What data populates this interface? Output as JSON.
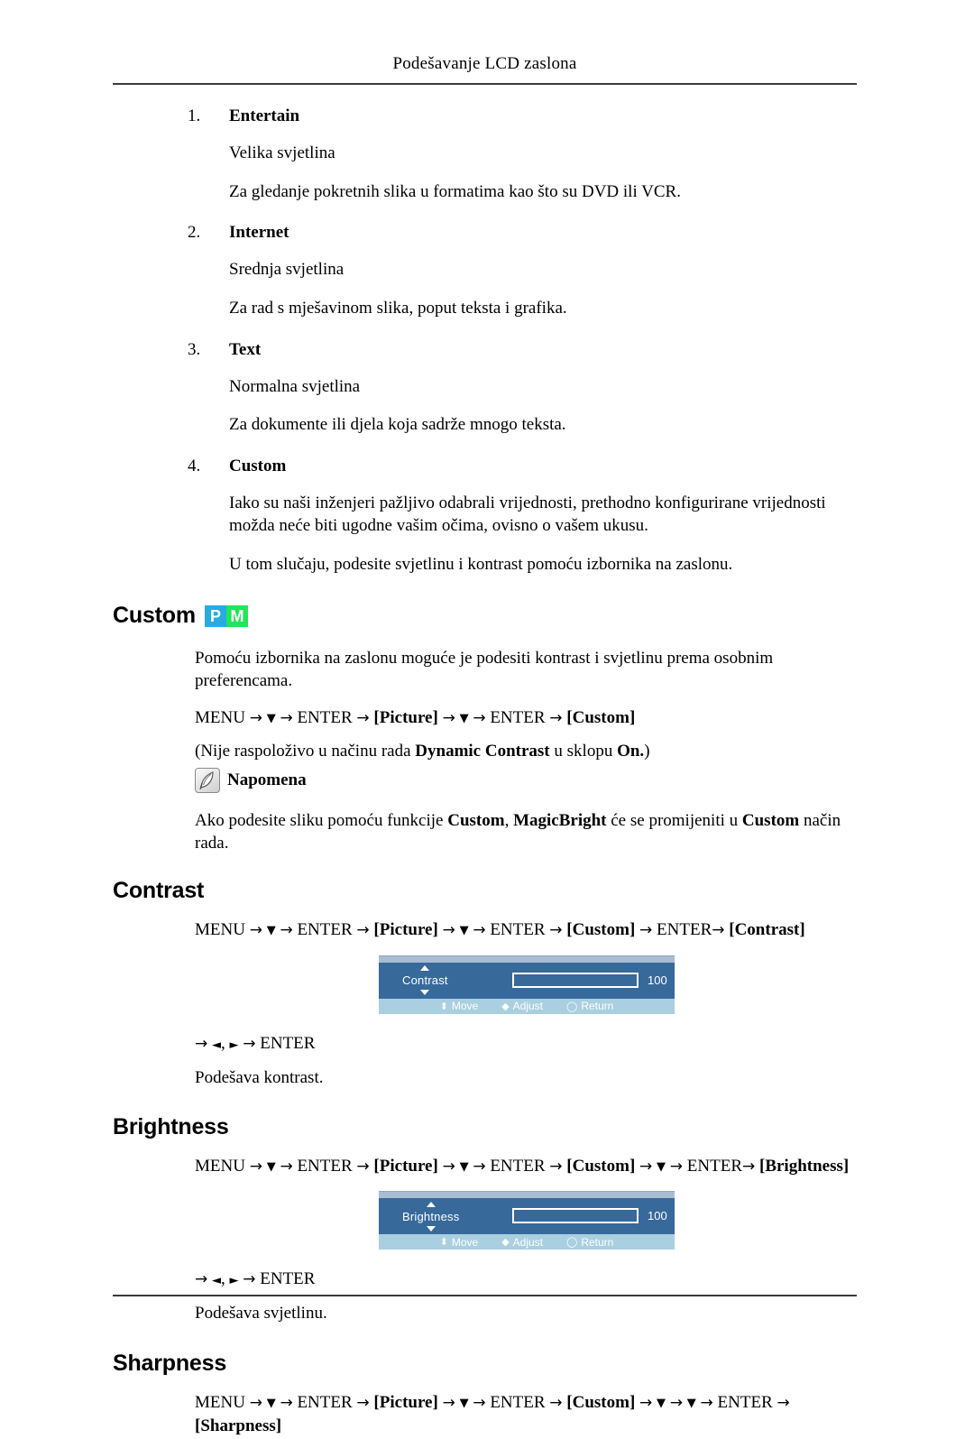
{
  "page": {
    "header_title": "Podešavanje LCD zaslona"
  },
  "magicbright_modes": [
    {
      "number": "1.",
      "title": "Entertain",
      "brightness": "Velika svjetlina",
      "description": "Za gledanje pokretnih slika u formatima kao što su DVD ili VCR."
    },
    {
      "number": "2.",
      "title": "Internet",
      "brightness": "Srednja svjetlina",
      "description": "Za rad s mješavinom slika, poput teksta i grafika."
    },
    {
      "number": "3.",
      "title": "Text",
      "brightness": "Normalna svjetlina",
      "description": "Za dokumente ili djela koja sadrže mnogo teksta."
    },
    {
      "number": "4.",
      "title": "Custom",
      "brightness": "Iako su naši inženjeri pažljivo odabrali vrijednosti, prethodno konfigurirane vrijednosti možda neće biti ugodne vašim očima, ovisno o vašem ukusu.",
      "description": "U tom slučaju, podesite svjetlinu i kontrast pomoću izbornika na zaslonu."
    }
  ],
  "custom_section": {
    "heading": "Custom",
    "badge_p": "P",
    "badge_m": "M",
    "badge_p_color": "#29abe2",
    "badge_m_color": "#22e559",
    "intro": "Pomoću izbornika na zaslonu moguće je podesiti kontrast i svjetlinu prema osobnim preferencama.",
    "menu_path": {
      "start": "MENU",
      "enter1": "ENTER",
      "picture": "[Picture]",
      "enter2": "ENTER",
      "target": "[Custom]"
    },
    "availability_note_pre": "(Nije raspoloživo u načinu rada ",
    "availability_note_bold1": "Dynamic Contrast",
    "availability_note_mid": " u sklopu ",
    "availability_note_bold2": "On.",
    "availability_note_post": ")",
    "note_label": "Napomena",
    "note_icon": "quill-note-icon",
    "note_text_pre": "Ako podesite sliku pomoću funkcije ",
    "note_text_b1": "Custom",
    "note_text_mid1": ", ",
    "note_text_b2": "MagicBright",
    "note_text_mid2": " će se promijeniti u ",
    "note_text_b3": "Custom",
    "note_text_post": " način rada."
  },
  "contrast_section": {
    "heading": "Contrast",
    "menu_path": {
      "start": "MENU",
      "enter1": "ENTER",
      "picture": "[Picture]",
      "enter2": "ENTER",
      "custom": "[Custom]",
      "enter3": "ENTER",
      "target": "[Contrast]"
    },
    "osd": {
      "label": "Contrast",
      "value": "100",
      "fill_percent": 100,
      "footer": [
        {
          "icon": "updown-arrow-icon",
          "glyph": "⬍",
          "label": "Move"
        },
        {
          "icon": "leftright-arrow-icon",
          "glyph": "◆",
          "label": "Adjust"
        },
        {
          "icon": "return-circle-icon",
          "glyph": "◯",
          "label": "Return"
        }
      ],
      "bg_color": "#37699b",
      "bar_color": "#eab94b",
      "footer_color": "#a9cfe0"
    },
    "key_hint": "ENTER",
    "description": "Podešava kontrast."
  },
  "brightness_section": {
    "heading": "Brightness",
    "menu_path": {
      "start": "MENU",
      "enter1": "ENTER",
      "picture": "[Picture]",
      "enter2": "ENTER",
      "custom": "[Custom]",
      "enter3": "ENTER",
      "target": "[Brightness]"
    },
    "osd": {
      "label": "Brightness",
      "value": "100",
      "fill_percent": 100,
      "footer": [
        {
          "icon": "updown-arrow-icon",
          "glyph": "⬍",
          "label": "Move"
        },
        {
          "icon": "leftright-arrow-icon",
          "glyph": "◆",
          "label": "Adjust"
        },
        {
          "icon": "return-circle-icon",
          "glyph": "◯",
          "label": "Return"
        }
      ]
    },
    "key_hint": "ENTER",
    "description": "Podešava svjetlinu."
  },
  "sharpness_section": {
    "heading": "Sharpness",
    "menu_path": {
      "start": "MENU",
      "enter1": "ENTER",
      "picture": "[Picture]",
      "enter2": "ENTER",
      "custom": "[Custom]",
      "enter3": "ENTER",
      "target": "[Sharpness]"
    }
  },
  "symbols": {
    "arrow_right": "→",
    "triangle_down": "▼",
    "triangle_left": "◄",
    "triangle_right": "►",
    "comma": ","
  }
}
